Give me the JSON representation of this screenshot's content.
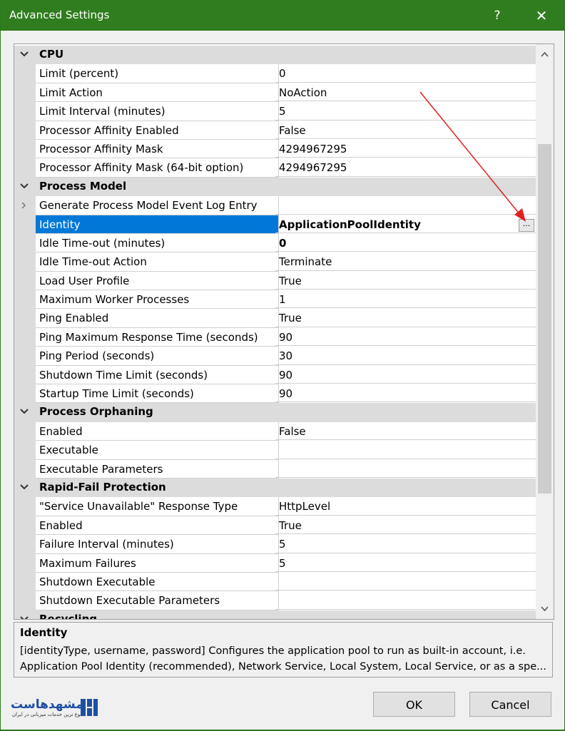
{
  "window": {
    "title": "Advanced Settings",
    "help": "?",
    "close": "✕"
  },
  "grid": {
    "sections": [
      {
        "name": "CSS-CPU",
        "label": "CPU"
      }
    ],
    "cpu": {
      "label": "CPU",
      "rows": [
        {
          "name": "Limit (percent)",
          "value": "0"
        },
        {
          "name": "Limit Action",
          "value": "NoAction"
        },
        {
          "name": "Limit Interval (minutes)",
          "value": "5"
        },
        {
          "name": "Processor Affinity Enabled",
          "value": "False"
        },
        {
          "name": "Processor Affinity Mask",
          "value": "4294967295"
        },
        {
          "name": "Processor Affinity Mask (64-bit option)",
          "value": "4294967295"
        }
      ]
    },
    "process_model": {
      "label": "Process Model",
      "rows": [
        {
          "name": "Generate Process Model Event Log Entry",
          "value": ""
        },
        {
          "name": "Identity",
          "value": "ApplicationPoolIdentity"
        },
        {
          "name": "Idle Time-out (minutes)",
          "value": "0"
        },
        {
          "name": "Idle Time-out Action",
          "value": "Terminate"
        },
        {
          "name": "Load User Profile",
          "value": "True"
        },
        {
          "name": "Maximum Worker Processes",
          "value": "1"
        },
        {
          "name": "Ping Enabled",
          "value": "True"
        },
        {
          "name": "Ping Maximum Response Time (seconds)",
          "value": "90"
        },
        {
          "name": "Ping Period (seconds)",
          "value": "30"
        },
        {
          "name": "Shutdown Time Limit (seconds)",
          "value": "90"
        },
        {
          "name": "Startup Time Limit (seconds)",
          "value": "90"
        }
      ],
      "ellipsis": "..."
    },
    "process_orphaning": {
      "label": "Process Orphaning",
      "rows": [
        {
          "name": "Enabled",
          "value": "False"
        },
        {
          "name": "Executable",
          "value": ""
        },
        {
          "name": "Executable Parameters",
          "value": ""
        }
      ]
    },
    "rapid_fail": {
      "label": "Rapid-Fail Protection",
      "rows": [
        {
          "name": "\"Service Unavailable\" Response Type",
          "value": "HttpLevel"
        },
        {
          "name": "Enabled",
          "value": "True"
        },
        {
          "name": "Failure Interval (minutes)",
          "value": "5"
        },
        {
          "name": "Maximum Failures",
          "value": "5"
        },
        {
          "name": "Shutdown Executable",
          "value": ""
        },
        {
          "name": "Shutdown Executable Parameters",
          "value": ""
        }
      ]
    },
    "recycling": {
      "label": "Recycling"
    }
  },
  "description": {
    "title": "Identity",
    "text": "[identityType, username, password] Configures the application pool to run as built-in account, i.e. Application Pool Identity (recommended), Network Service, Local System, Local Service, or as a spe..."
  },
  "buttons": {
    "ok": "OK",
    "cancel": "Cancel"
  },
  "logo": {
    "text": "مشهدهاست",
    "tagline": "متنوع ترین خدمات میزبانی در ایران"
  },
  "colors": {
    "titlebar": "#2f7d1e",
    "selection": "#0078d7",
    "annotation_arrow": "#e02020"
  }
}
